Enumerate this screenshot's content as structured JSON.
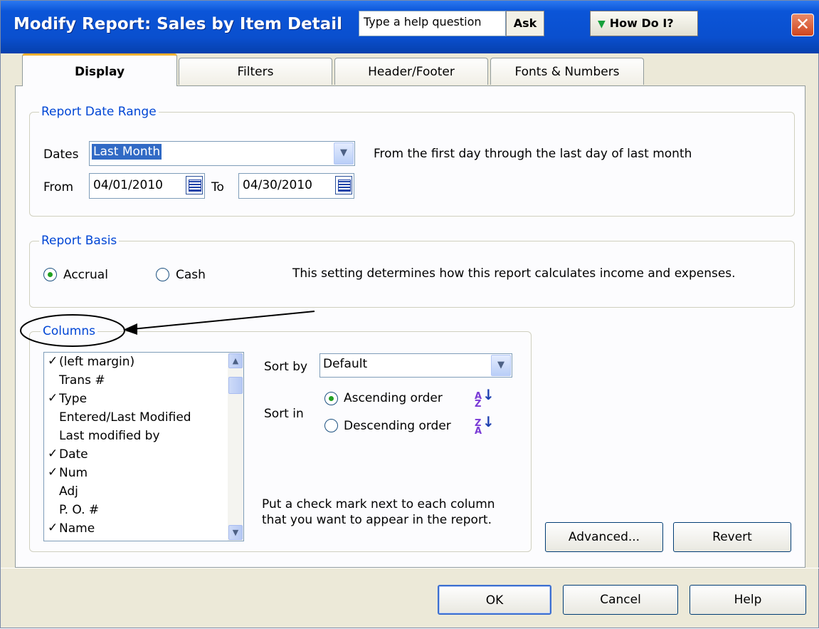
{
  "window": {
    "title": "Modify Report: Sales by Item Detail",
    "help_placeholder": "Type a help question",
    "ask_label": "Ask",
    "how_do_i_label": "How Do I?",
    "close_glyph": "✕"
  },
  "tabs": [
    {
      "label": "Display",
      "active": true
    },
    {
      "label": "Filters",
      "active": false
    },
    {
      "label": "Header/Footer",
      "active": false
    },
    {
      "label": "Fonts & Numbers",
      "active": false
    }
  ],
  "date_range": {
    "group_label": "Report Date Range",
    "dates_label": "Dates",
    "dates_value": "Last Month",
    "description": "From the first day through the last day of last month",
    "from_label": "From",
    "from_value": "04/01/2010",
    "to_label": "To",
    "to_value": "04/30/2010"
  },
  "basis": {
    "group_label": "Report Basis",
    "accrual_label": "Accrual",
    "cash_label": "Cash",
    "selected": "Accrual",
    "description": "This setting determines how this report calculates income and expenses."
  },
  "columns": {
    "group_label": "Columns",
    "items": [
      {
        "label": "(left margin)",
        "checked": true
      },
      {
        "label": "Trans #",
        "checked": false
      },
      {
        "label": "Type",
        "checked": true
      },
      {
        "label": "Entered/Last Modified",
        "checked": false
      },
      {
        "label": "Last modified by",
        "checked": false
      },
      {
        "label": "Date",
        "checked": true
      },
      {
        "label": "Num",
        "checked": true
      },
      {
        "label": "Adj",
        "checked": false
      },
      {
        "label": "P. O. #",
        "checked": false
      },
      {
        "label": "Name",
        "checked": true
      }
    ],
    "check_glyph": "✓",
    "sort_by_label": "Sort by",
    "sort_by_value": "Default",
    "sort_in_label": "Sort in",
    "ascending_label": "Ascending order",
    "descending_label": "Descending order",
    "sort_selected": "Ascending order",
    "hint_line1": "Put a check mark next to each column",
    "hint_line2": "that you want to appear in the report.",
    "advanced_label": "Advanced...",
    "revert_label": "Revert"
  },
  "footer": {
    "ok_label": "OK",
    "cancel_label": "Cancel",
    "help_label": "Help"
  },
  "colors": {
    "title_bar": "#0a4fce",
    "group_label": "#0046d5",
    "selection": "#316ac5",
    "radio_on": "#21a121",
    "annotation": "#000000"
  }
}
